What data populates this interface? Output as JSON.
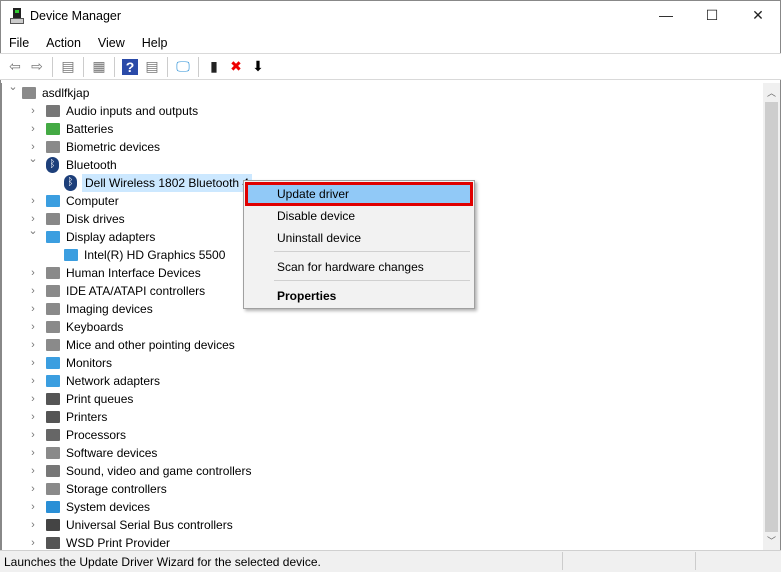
{
  "window": {
    "title": "Device Manager",
    "controls": {
      "minimize": "—",
      "maximize": "☐",
      "close": "✕"
    }
  },
  "menubar": [
    "File",
    "Action",
    "View",
    "Help"
  ],
  "toolbar": [
    {
      "icon": "back-arrow-icon",
      "glyph": "⇦"
    },
    {
      "icon": "forward-arrow-icon",
      "glyph": "⇨"
    },
    {
      "sep": true
    },
    {
      "icon": "show-hide-console-tree-icon",
      "glyph": "▤"
    },
    {
      "sep": true
    },
    {
      "icon": "properties-icon",
      "glyph": "▦"
    },
    {
      "sep": true
    },
    {
      "icon": "help-icon",
      "glyph": "?"
    },
    {
      "icon": "show-action-pane-icon",
      "glyph": "▤"
    },
    {
      "sep": true
    },
    {
      "icon": "scan-hardware-icon",
      "glyph": "🖵"
    },
    {
      "sep": true
    },
    {
      "icon": "update-driver-icon",
      "glyph": "▮"
    },
    {
      "icon": "uninstall-icon",
      "glyph": "✖"
    },
    {
      "icon": "disable-download-icon",
      "glyph": "⬇"
    }
  ],
  "tree": {
    "root": "asdlfkjap",
    "items": [
      {
        "label": "Audio inputs and outputs",
        "icon": "speaker-icon",
        "expanded": false
      },
      {
        "label": "Batteries",
        "icon": "battery-icon",
        "expanded": false
      },
      {
        "label": "Biometric devices",
        "icon": "fingerprint-icon",
        "expanded": false
      },
      {
        "label": "Bluetooth",
        "icon": "bluetooth-icon",
        "expanded": true,
        "children": [
          {
            "label": "Dell Wireless 1802 Bluetooth 4",
            "icon": "bluetooth-icon",
            "selected": true
          }
        ]
      },
      {
        "label": "Computer",
        "icon": "monitor-icon",
        "expanded": false
      },
      {
        "label": "Disk drives",
        "icon": "disk-drive-icon",
        "expanded": false
      },
      {
        "label": "Display adapters",
        "icon": "display-adapter-icon",
        "expanded": true,
        "children": [
          {
            "label": "Intel(R) HD Graphics 5500",
            "icon": "display-adapter-icon"
          }
        ]
      },
      {
        "label": "Human Interface Devices",
        "icon": "hid-icon",
        "expanded": false
      },
      {
        "label": "IDE ATA/ATAPI controllers",
        "icon": "ide-controller-icon",
        "expanded": false
      },
      {
        "label": "Imaging devices",
        "icon": "camera-icon",
        "expanded": false
      },
      {
        "label": "Keyboards",
        "icon": "keyboard-icon",
        "expanded": false
      },
      {
        "label": "Mice and other pointing devices",
        "icon": "mouse-icon",
        "expanded": false
      },
      {
        "label": "Monitors",
        "icon": "monitor-icon",
        "expanded": false
      },
      {
        "label": "Network adapters",
        "icon": "network-adapter-icon",
        "expanded": false
      },
      {
        "label": "Print queues",
        "icon": "printer-icon",
        "expanded": false
      },
      {
        "label": "Printers",
        "icon": "printer-icon",
        "expanded": false
      },
      {
        "label": "Processors",
        "icon": "processor-icon",
        "expanded": false
      },
      {
        "label": "Software devices",
        "icon": "software-device-icon",
        "expanded": false
      },
      {
        "label": "Sound, video and game controllers",
        "icon": "speaker-icon",
        "expanded": false
      },
      {
        "label": "Storage controllers",
        "icon": "storage-controller-icon",
        "expanded": false
      },
      {
        "label": "System devices",
        "icon": "system-device-icon",
        "expanded": false
      },
      {
        "label": "Universal Serial Bus controllers",
        "icon": "usb-icon",
        "expanded": false
      },
      {
        "label": "WSD Print Provider",
        "icon": "printer-icon",
        "expanded": false
      }
    ]
  },
  "context_menu": {
    "items": [
      {
        "label": "Update driver",
        "highlighted": true
      },
      {
        "label": "Disable device"
      },
      {
        "label": "Uninstall device"
      },
      {
        "sep": true
      },
      {
        "label": "Scan for hardware changes"
      },
      {
        "sep": true
      },
      {
        "label": "Properties",
        "bold": true
      }
    ]
  },
  "status": "Launches the Update Driver Wizard for the selected device.",
  "colors": {
    "selection": "#cce8ff",
    "menu_highlight": "#91c9f7",
    "highlight_border": "#e00000"
  }
}
